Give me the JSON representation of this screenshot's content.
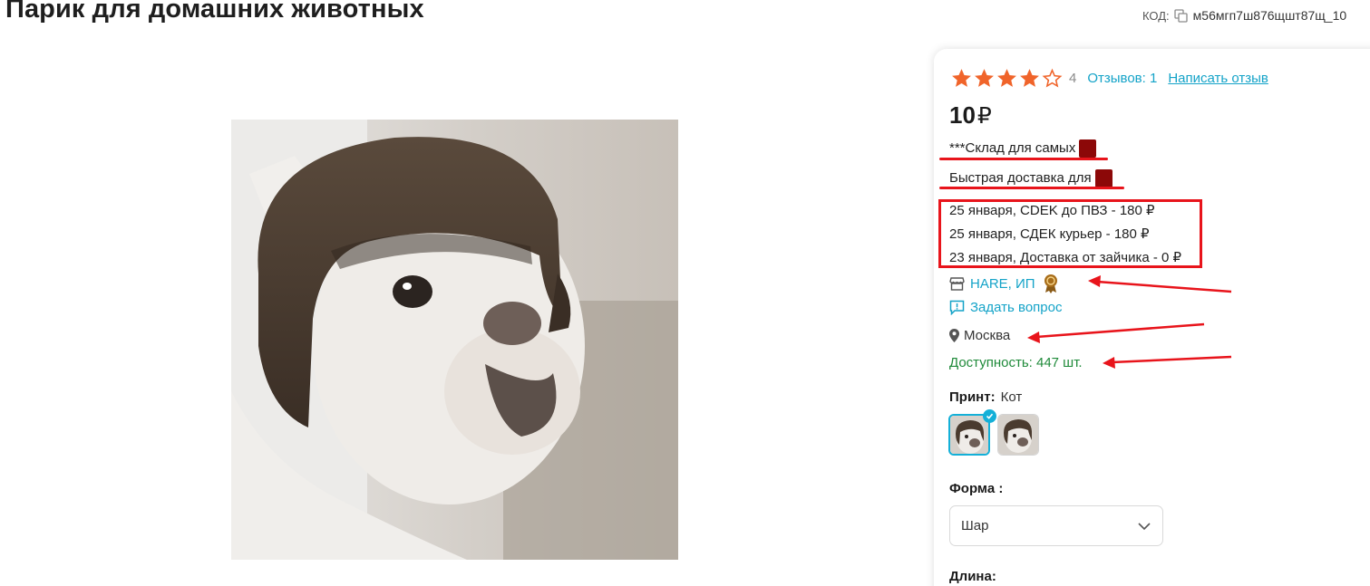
{
  "product": {
    "title": "Парик для домашних животных",
    "sku_label": "КОД:",
    "sku_value": "м56мгп7ш876щшт87щ_10"
  },
  "rating": {
    "stars_filled": 4,
    "stars_total": 5,
    "value": "4",
    "reviews_label": "Отзывов: 1",
    "write_review_label": "Написать отзыв"
  },
  "price": {
    "amount": "10",
    "currency": "₽"
  },
  "warehouse": {
    "text": "***Склад для самых"
  },
  "fast_delivery": {
    "text": "Быстрая доставка для"
  },
  "delivery_options": [
    "25 января, CDEK до ПВЗ - 180 ₽",
    "25 января, СДЕК курьер - 180 ₽",
    "23 января, Доставка от зайчика - 0 ₽"
  ],
  "seller": {
    "name": "HARE, ИП",
    "ask_label": "Задать вопрос",
    "city": "Москва",
    "availability": "Доступность: 447 шт."
  },
  "options": {
    "print_label": "Принт:",
    "print_value": "Кот",
    "form_label": "Форма :",
    "form_value": "Шар",
    "length_label": "Длина:"
  },
  "colors": {
    "accent": "#14a3c8",
    "star": "#f0642a",
    "availability": "#1f8a3a",
    "annotation_red": "#e8141b",
    "redaction": "#8c0808"
  },
  "icons": {
    "copy": "copy-icon",
    "shop": "shop-icon",
    "badge": "award-badge-icon",
    "chat": "chat-icon",
    "pin": "map-pin-icon",
    "chevron": "chevron-down-icon",
    "check": "check-icon"
  }
}
